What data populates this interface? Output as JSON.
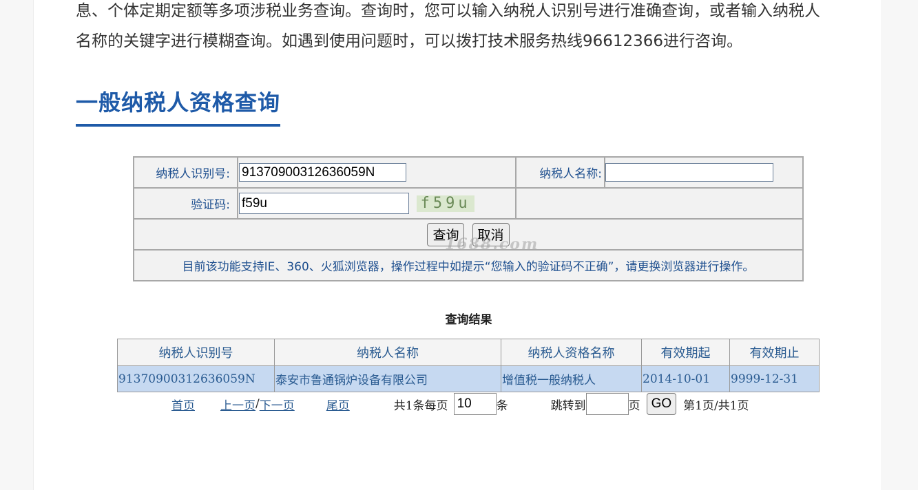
{
  "intro": {
    "line1": "息、个体定期定额等多项涉税业务查询。查询时，您可以输入纳税人识别号进行准确查询，或者输入纳税人",
    "line2": "名称的关键字进行模糊查询。如遇到使用问题时，可以拨打技术服务热线96612366进行咨询。"
  },
  "section_title": "一般纳税人资格查询",
  "form": {
    "taxpayer_id_label": "纳税人识别号:",
    "taxpayer_id_value": "91370900312636059N",
    "taxpayer_name_label": "纳税人名称:",
    "taxpayer_name_value": "",
    "captcha_label": "验证码:",
    "captcha_value": "f59u",
    "captcha_image_text": "f59u",
    "query_button": "查询",
    "cancel_button": "取消",
    "notice": "目前该功能支持IE、360、火狐浏览器，操作过程中如提示“您输入的验证码不正确”，请更换浏览器进行操作。"
  },
  "watermark": "1688.com",
  "results": {
    "title": "查询结果",
    "headers": [
      "纳税人识别号",
      "纳税人名称",
      "纳税人资格名称",
      "有效期起",
      "有效期止"
    ],
    "rows": [
      [
        "91370900312636059N",
        "泰安市鲁通锅炉设备有限公司",
        "增值税一般纳税人",
        "2014-10-01",
        "9999-12-31"
      ]
    ]
  },
  "pager": {
    "first": "首页",
    "prev": "上一页",
    "separator": "/",
    "next": "下一页",
    "last": "尾页",
    "total_prefix": "共1条每页",
    "page_size": "10",
    "total_suffix": "条",
    "jump_label": "跳转到",
    "jump_value": "",
    "page_unit": "页",
    "go_button": "GO",
    "page_status": "第1页/共1页"
  }
}
